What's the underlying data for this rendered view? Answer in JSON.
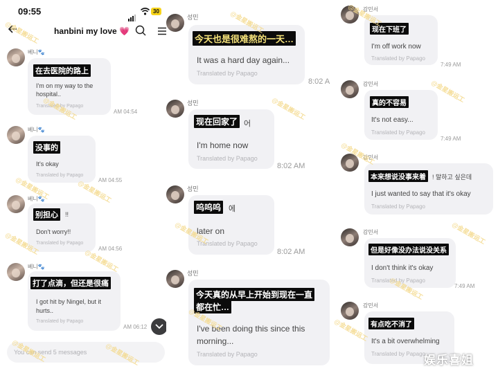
{
  "status": {
    "time": "09:55",
    "battery": "30"
  },
  "header": {
    "title": "hanbini my love",
    "heart": "💗"
  },
  "col1": {
    "messages": [
      {
        "name": "베니🐾",
        "cn": "在去医院的路上",
        "orig": "I'm on my way to the hospital..",
        "translated_by": "Translated by Papago",
        "time": "AM 04:54"
      },
      {
        "name": "베니🐾",
        "cn": "没事的",
        "orig": "It's okay",
        "translated_by": "Translated by Papago",
        "time": "AM 04:55"
      },
      {
        "name": "베니🐾",
        "cn": "别担心",
        "cn_tail": "!!",
        "orig": "Don't worry!!",
        "translated_by": "Translated by Papago",
        "time": "AM 04:56"
      },
      {
        "name": "베니🐾",
        "cn": "打了点滴，但还是很痛",
        "orig": "I got hit by Ningel, but it hurts..",
        "translated_by": "Translated by Papago",
        "time": "AM 06:12"
      }
    ],
    "input_placeholder": "You can send 5 messages"
  },
  "col2": {
    "messages": [
      {
        "name": "",
        "cn": "今天也是很难熬的一天…",
        "orig": "It was a hard day again...",
        "translated_by": "Translated by Papago",
        "time": "8:02 A"
      },
      {
        "name": "성민",
        "cn": "现在回家了",
        "cn_tail": "어",
        "orig": "I'm home now",
        "translated_by": "Translated by Papago",
        "time": "8:02 AM"
      },
      {
        "name": "성민",
        "cn": "呜呜呜",
        "cn_tail": "에",
        "orig": "later on",
        "translated_by": "Translated by Papago",
        "time": "8:02 AM"
      },
      {
        "name": "성민",
        "cn": "今天真的从早上开始到现在一直都在忙…",
        "cn_line1": "今天真的从早上开始到现在一直",
        "cn_line2": "都在忙…",
        "orig": "I've been doing this since this morning...",
        "translated_by": "Translated by Papago",
        "time": ""
      }
    ],
    "top_name": "성민"
  },
  "col3": {
    "messages": [
      {
        "name": "강민서",
        "cn": "现在下班了",
        "orig": "I'm off work now",
        "translated_by": "Translated by Papago",
        "time": "7:49 AM"
      },
      {
        "name": "강민서",
        "cn": "真的不容易",
        "orig": "It's not easy...",
        "translated_by": "Translated by Papago",
        "time": "7:49 AM"
      },
      {
        "name": "강민서",
        "cn": "本来想说没事来着",
        "cn_tail": "! 말하고 싶은데",
        "orig": "I just wanted to say that it's okay",
        "translated_by": "Translated by Papago",
        "time": ""
      },
      {
        "name": "강민서",
        "cn": "但是好像没办法说没关系",
        "orig": "I don't think it's okay",
        "translated_by": "Translated by Papago",
        "time": "7:49 AM"
      },
      {
        "name": "강민서",
        "cn": "有点吃不消了",
        "orig": "It's a bit overwhelming",
        "translated_by": "Translated by Papago",
        "time": ""
      }
    ]
  },
  "watermark": {
    "repeat_text": "@金星搬运工",
    "logo": "娱乐喜姐"
  },
  "colors": {
    "bubble": "#f1f1f4",
    "caption_bg": "#0b0b0b",
    "heart": "#e8389a",
    "battery": "#f6d31a"
  },
  "icons": [
    "back-arrow-icon",
    "search-icon",
    "menu-icon",
    "chevron-down-icon",
    "signal-icon",
    "wifi-icon"
  ]
}
